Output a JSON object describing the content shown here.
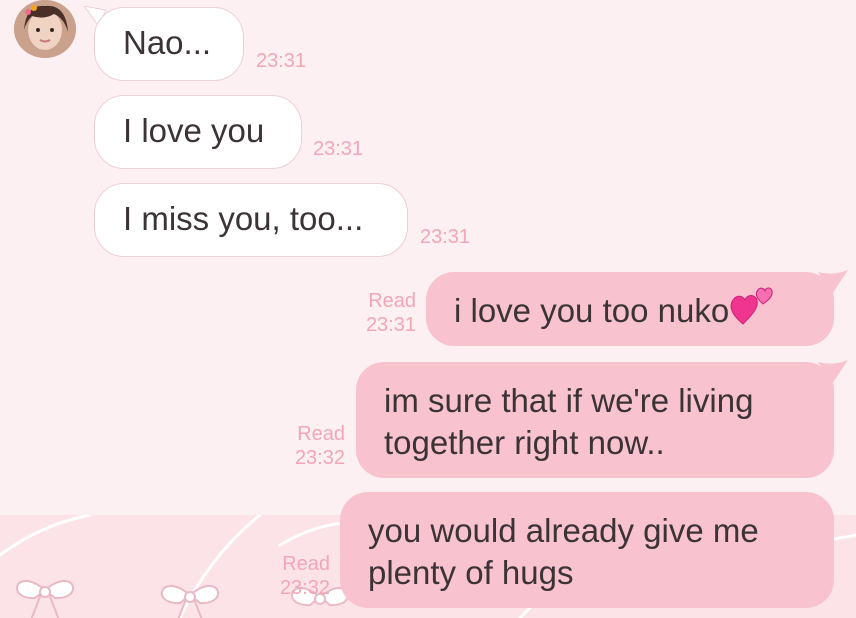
{
  "messages": [
    {
      "dir": "in",
      "text": "Nao...",
      "time": "23:31"
    },
    {
      "dir": "in",
      "text": "I love you",
      "time": "23:31"
    },
    {
      "dir": "in",
      "text": "I miss you, too...",
      "time": "23:31"
    },
    {
      "dir": "out",
      "text": "i love you too nuko",
      "emoji": "two-hearts-icon",
      "read": "Read",
      "time": "23:31"
    },
    {
      "dir": "out",
      "line1": "im sure that if we're living",
      "line2": "together right now..",
      "read": "Read",
      "time": "23:32"
    },
    {
      "dir": "out",
      "line1": "you would already give me",
      "line2": "plenty of hugs",
      "read": "Read",
      "time": "23:32"
    }
  ],
  "colors": {
    "background": "#fdf0f2",
    "incoming_bubble": "#ffffff",
    "outgoing_bubble": "#f8c3cf",
    "timestamp": "#f2a6b6",
    "text": "#3b3336"
  }
}
